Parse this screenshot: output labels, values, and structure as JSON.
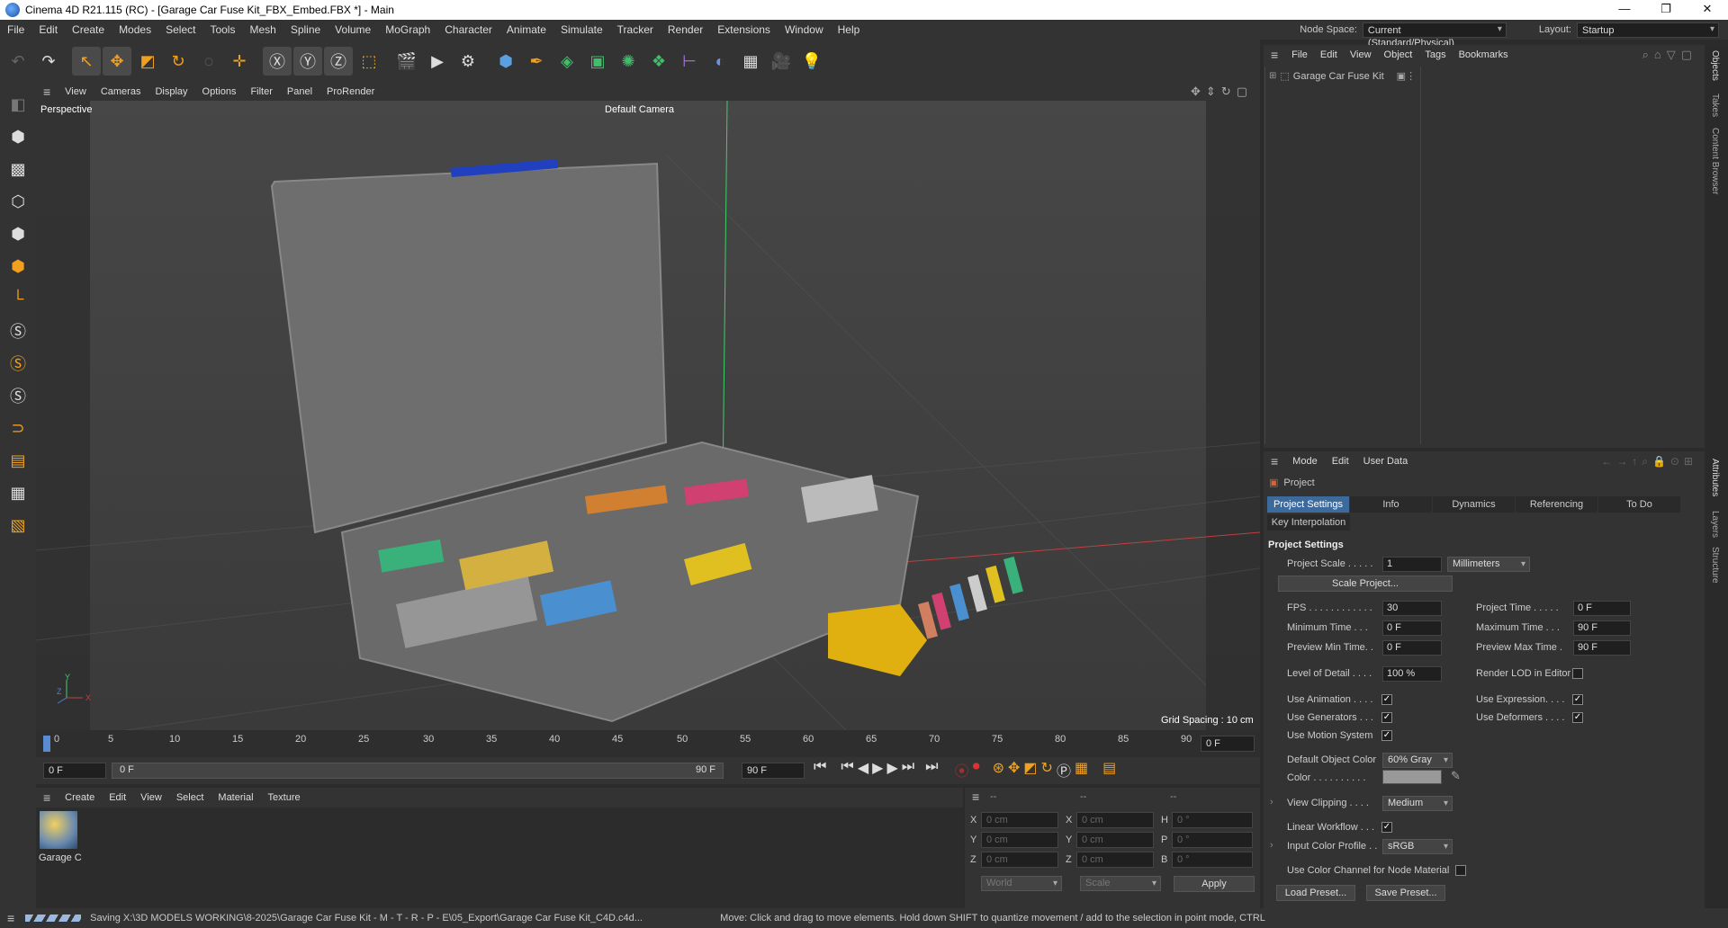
{
  "window": {
    "title": "Cinema 4D R21.115 (RC) - [Garage Car Fuse Kit_FBX_Embed.FBX *] - Main",
    "minimize": "—",
    "maximize": "❐",
    "close": "✕"
  },
  "menubar": {
    "items": [
      "File",
      "Edit",
      "Create",
      "Modes",
      "Select",
      "Tools",
      "Mesh",
      "Spline",
      "Volume",
      "MoGraph",
      "Character",
      "Animate",
      "Simulate",
      "Tracker",
      "Render",
      "Extensions",
      "Window",
      "Help"
    ],
    "node_space_label": "Node Space:",
    "node_space_value": "Current (Standard/Physical)",
    "layout_label": "Layout:",
    "layout_value": "Startup"
  },
  "viewport": {
    "menu": [
      "View",
      "Cameras",
      "Display",
      "Options",
      "Filter",
      "Panel",
      "ProRender"
    ],
    "name": "Perspective",
    "camera": "Default Camera",
    "grid_spacing": "Grid Spacing : 10 cm",
    "axis_y": "Y",
    "axis_z": "Z",
    "axis_x": "X"
  },
  "timeline": {
    "ticks": [
      "0",
      "5",
      "10",
      "15",
      "20",
      "25",
      "30",
      "35",
      "40",
      "45",
      "50",
      "55",
      "60",
      "65",
      "70",
      "75",
      "80",
      "85",
      "90"
    ],
    "current_frame_display": "0 F",
    "start_field": "0 F",
    "range_start": "0 F",
    "range_end": "90 F",
    "end_field": "90 F"
  },
  "material": {
    "menu": [
      "Create",
      "Edit",
      "View",
      "Select",
      "Material",
      "Texture"
    ],
    "item_label": "Garage C"
  },
  "coords": {
    "header": [
      "--",
      "--",
      "--"
    ],
    "rows": [
      {
        "a": "X",
        "av": "0 cm",
        "b": "X",
        "bv": "0 cm",
        "c": "H",
        "cv": "0 °"
      },
      {
        "a": "Y",
        "av": "0 cm",
        "b": "Y",
        "bv": "0 cm",
        "c": "P",
        "cv": "0 °"
      },
      {
        "a": "Z",
        "av": "0 cm",
        "b": "Z",
        "bv": "0 cm",
        "c": "B",
        "cv": "0 °"
      }
    ],
    "world": "World",
    "scale": "Scale",
    "apply": "Apply"
  },
  "status": {
    "left": "Saving X:\\3D MODELS WORKING\\8-2025\\Garage Car Fuse Kit - M - T - R - P - E\\05_Export\\Garage Car Fuse Kit_C4D.c4d...",
    "right": "Move: Click and drag to move elements. Hold down SHIFT to quantize movement / add to the selection in point mode, CTRL"
  },
  "objects": {
    "menu": [
      "File",
      "Edit",
      "View",
      "Object",
      "Tags",
      "Bookmarks"
    ],
    "items": [
      {
        "name": "Garage Car Fuse Kit"
      }
    ]
  },
  "right_tabs": [
    "Objects",
    "Takes",
    "Content Browser",
    "Attributes",
    "Layers",
    "Structure"
  ],
  "attributes": {
    "menu": [
      "Mode",
      "Edit",
      "User Data"
    ],
    "object": "Project",
    "tabs": [
      "Project Settings",
      "Info",
      "Dynamics",
      "Referencing",
      "To Do"
    ],
    "tab2": "Key Interpolation",
    "section": "Project Settings",
    "project_scale_label": "Project Scale . . . . .",
    "project_scale_value": "1",
    "project_scale_unit": "Millimeters",
    "scale_project_btn": "Scale Project...",
    "fps_label": "FPS . . . . . . . . . . . .",
    "fps_value": "30",
    "project_time_label": "Project Time . . . . .",
    "project_time_value": "0 F",
    "min_time_label": "Minimum Time . . .",
    "min_time_value": "0 F",
    "max_time_label": "Maximum Time . . .",
    "max_time_value": "90 F",
    "prev_min_label": "Preview Min Time. .",
    "prev_min_value": "0 F",
    "prev_max_label": "Preview Max Time .",
    "prev_max_value": "90 F",
    "lod_label": "Level of Detail . . . .",
    "lod_value": "100 %",
    "render_lod_label": "Render LOD in Editor",
    "use_animation_label": "Use Animation . . . .",
    "use_expression_label": "Use Expression. . . .",
    "use_generators_label": "Use Generators . . .",
    "use_deformers_label": "Use Deformers . . . .",
    "use_motion_label": "Use Motion System",
    "default_color_label": "Default Object Color",
    "default_color_value": "60% Gray",
    "color_label": "Color . . . . . . . . . .",
    "view_clipping_label": "View Clipping . . . .",
    "view_clipping_value": "Medium",
    "linear_workflow_label": "Linear Workflow . . .",
    "input_color_label": "Input Color Profile . .",
    "input_color_value": "sRGB",
    "color_channel_label": "Use Color Channel for Node Material",
    "load_preset": "Load Preset...",
    "save_preset": "Save Preset...",
    "check": "✓"
  }
}
